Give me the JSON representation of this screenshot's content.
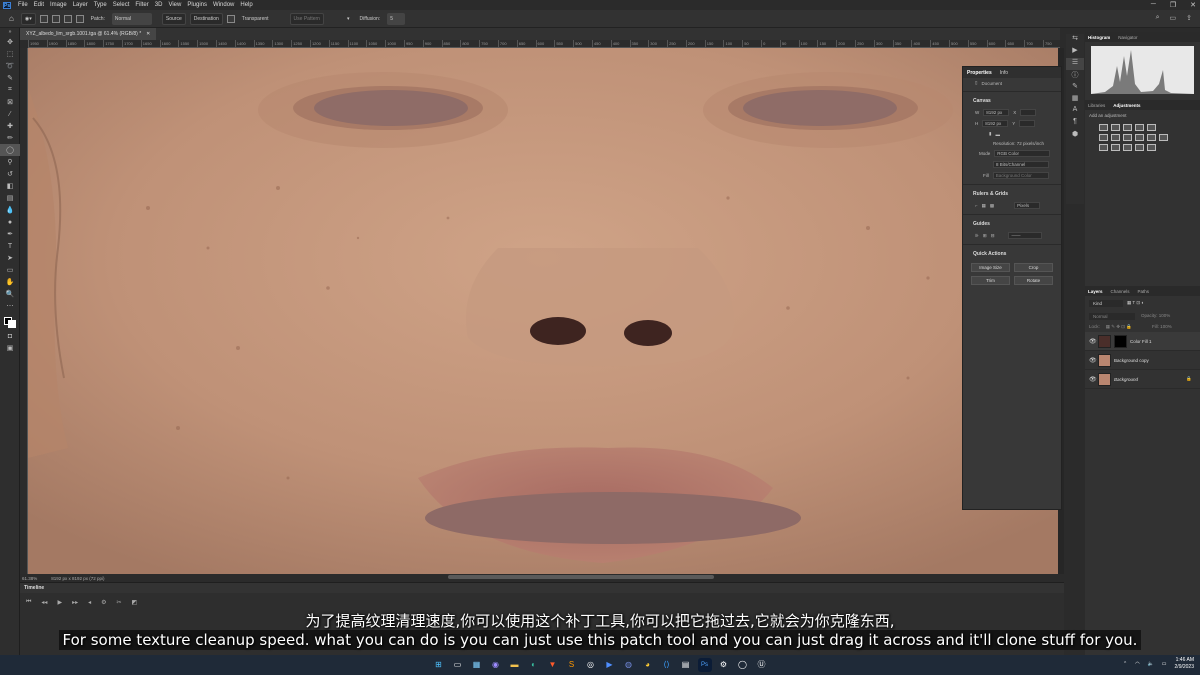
{
  "menu": [
    "File",
    "Edit",
    "Image",
    "Layer",
    "Type",
    "Select",
    "Filter",
    "3D",
    "View",
    "Plugins",
    "Window",
    "Help"
  ],
  "app_icon": "Ps",
  "options_bar": {
    "patch_label": "Patch:",
    "patch_mode": "Normal",
    "source": "Source",
    "destination": "Destination",
    "transparent": "Transparent",
    "use_pattern": "Use Pattern",
    "diffusion_label": "Diffusion:",
    "diffusion_value": "5"
  },
  "document": {
    "tab_title": "XYZ_albedo_lim_srgb.1001.tga @ 61.4% (RGB/8) *",
    "zoom": "61.38%",
    "dimensions": "8192 px x 8192 px (72 ppi)"
  },
  "ruler_ticks": [
    "1950",
    "1900",
    "1850",
    "1800",
    "1750",
    "1700",
    "1650",
    "1600",
    "1550",
    "1500",
    "1450",
    "1400",
    "1350",
    "1300",
    "1250",
    "1200",
    "1150",
    "1100",
    "1050",
    "1000",
    "950",
    "900",
    "850",
    "800",
    "750",
    "700",
    "650",
    "600",
    "550",
    "500",
    "450",
    "400",
    "350",
    "300",
    "250",
    "200",
    "150",
    "100",
    "50",
    "0",
    "50",
    "100",
    "150",
    "200",
    "250",
    "300",
    "350",
    "400",
    "450",
    "500",
    "550",
    "600",
    "650",
    "700",
    "750"
  ],
  "timeline": {
    "title": "Timeline"
  },
  "properties": {
    "tabs": [
      "Properties",
      "Info"
    ],
    "document_label": "Document",
    "canvas_title": "Canvas",
    "w_label": "W",
    "w_value": "8192 px",
    "h_label": "H",
    "h_value": "8192 px",
    "x_label": "X",
    "y_label": "Y",
    "resolution": "Resolution: 72 pixels/inch",
    "mode_label": "Mode",
    "mode_value": "RGB Color",
    "bits_value": "8 Bits/Channel",
    "fill_label": "Fill",
    "fill_value": "Background Color",
    "rulers_title": "Rulers & Grids",
    "rulers_unit": "Pixels",
    "guides_title": "Guides",
    "quick_actions_title": "Quick Actions",
    "qa": [
      "Image Size",
      "Crop",
      "Trim",
      "Rotate"
    ]
  },
  "histogram_tabs": [
    "Histogram",
    "Navigator"
  ],
  "adjust_tabs": [
    "Libraries",
    "Adjustments"
  ],
  "adjust_hint": "Add an adjustment",
  "layers_panel": {
    "tabs": [
      "Layers",
      "Channels",
      "Paths"
    ],
    "kind": "Kind",
    "blend": "Normal",
    "opacity": "Opacity: 100%",
    "lock_label": "Lock:",
    "fill": "Fill: 100%",
    "layers": [
      {
        "name": "Color Fill 1",
        "thumb": "#4a2e2a"
      },
      {
        "name": "Background copy",
        "thumb": "#b98670"
      },
      {
        "name": "Background",
        "thumb": "#b98670"
      }
    ]
  },
  "subtitle": {
    "cn": "为了提高纹理清理速度,你可以使用这个补丁工具,你可以把它拖过去,它就会为你克隆东西,",
    "en": "For some texture cleanup speed. what you can do is you can just use this patch tool and you can just drag it across and it'll clone stuff for you."
  },
  "taskbar": {
    "time": "1:46 AM",
    "date": "2/9/2023"
  },
  "colors": {
    "skin": "#c49a7d",
    "patch_fill": "#8e6a66",
    "accent": "#1473e6"
  }
}
